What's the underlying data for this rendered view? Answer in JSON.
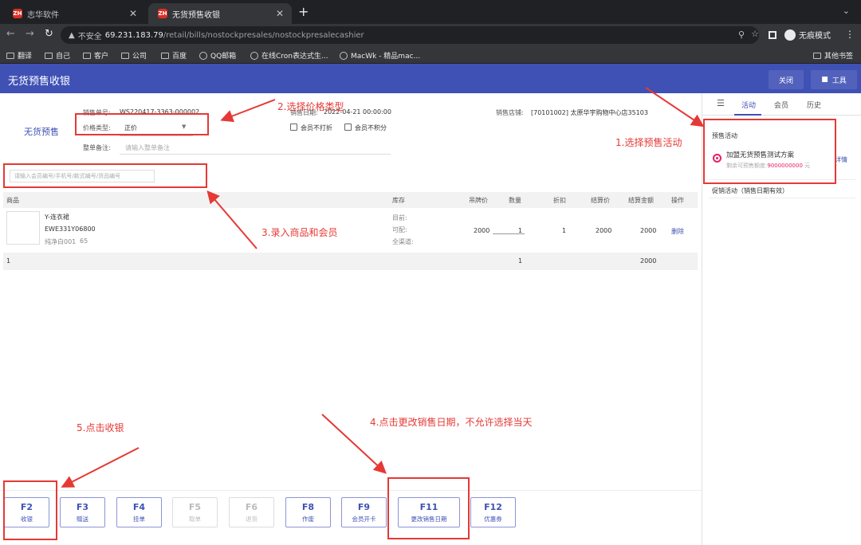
{
  "browser": {
    "tabs": [
      {
        "label": "志华软件",
        "active": false
      },
      {
        "label": "无货预售收银",
        "active": true
      }
    ],
    "tab_icon_text": "ZH",
    "insecure_label": "不安全",
    "url_host": "69.231.183.79",
    "url_path": "/retail/bills/nostockpresales/nostockpresalecashier",
    "incognito_label": "无痕模式",
    "bookmarks": [
      "翻译",
      "自己",
      "客户",
      "公司",
      "百度",
      "QQ邮箱",
      "在线Cron表达式生...",
      "MacWk - 精品mac..."
    ],
    "other_bookmarks": "其他书签"
  },
  "app": {
    "title": "无货预售收银",
    "close_label": "关闭",
    "tools_label": "工具"
  },
  "bill": {
    "type_label": "无货预售",
    "no_label": "销售单号:",
    "no_value": "WS220417-3363-000002",
    "price_type_label": "价格类型:",
    "price_type_value": "正价",
    "remark_label": "整单备注:",
    "remark_placeholder": "请输入整单备注",
    "date_label": "销售日期:",
    "date_value": "2022-04-21 00:00:00",
    "no_discount_label": "会员不打折",
    "no_points_label": "会员不积分",
    "store_label": "销售店铺:",
    "store_value": "[70101002] 太原华宇购物中心店35103",
    "member_placeholder": "请输入会员编号/手机号/款式编号/货品编号"
  },
  "grid": {
    "headers": [
      "商品",
      "库存",
      "吊牌价",
      "数量",
      "折扣",
      "结算价",
      "结算金额",
      "操作"
    ],
    "row": {
      "name": "Y-连衣裙",
      "code": "EWE331Y06800",
      "spec": "纯净白001",
      "size": "65",
      "stock_current": "目前:",
      "stock_available": "可配:",
      "stock_channel": "全渠道:",
      "tag_price": "2000",
      "qty": "1",
      "discount": "1",
      "settle_price": "2000",
      "settle_amount": "2000",
      "delete": "删除"
    },
    "footer": {
      "count": "1",
      "qty": "1",
      "amount": "2000"
    }
  },
  "fkeys": [
    {
      "key": "F2",
      "label": "收银",
      "enabled": true
    },
    {
      "key": "F3",
      "label": "赠送",
      "enabled": true
    },
    {
      "key": "F4",
      "label": "挂单",
      "enabled": true
    },
    {
      "key": "F5",
      "label": "取单",
      "enabled": false
    },
    {
      "key": "F6",
      "label": "退货",
      "enabled": false
    },
    {
      "key": "F8",
      "label": "作废",
      "enabled": true
    },
    {
      "key": "F9",
      "label": "会员开卡",
      "enabled": true
    },
    {
      "key": "F11",
      "label": "更改销售日期",
      "enabled": true
    },
    {
      "key": "F12",
      "label": "优惠券",
      "enabled": true
    }
  ],
  "side": {
    "tabs": [
      "活动",
      "会员",
      "历史"
    ],
    "presale_title": "预售活动",
    "plan_name": "加盟无货预售测试方案",
    "remaining_prefix": "剩余可预售额度:",
    "remaining_amount": "9000000000",
    "remaining_unit": "元",
    "detail_link": "详情",
    "promo_title": "促销活动（销售日期有效）"
  },
  "annotations": [
    "1.选择预售活动",
    "2.选择价格类型",
    "3.录入商品和会员",
    "4.点击更改销售日期，不允许选择当天",
    "5.点击收银"
  ],
  "colors": {
    "primary": "#3f51b5",
    "annotation": "#e53935",
    "accent": "#e91e63"
  }
}
